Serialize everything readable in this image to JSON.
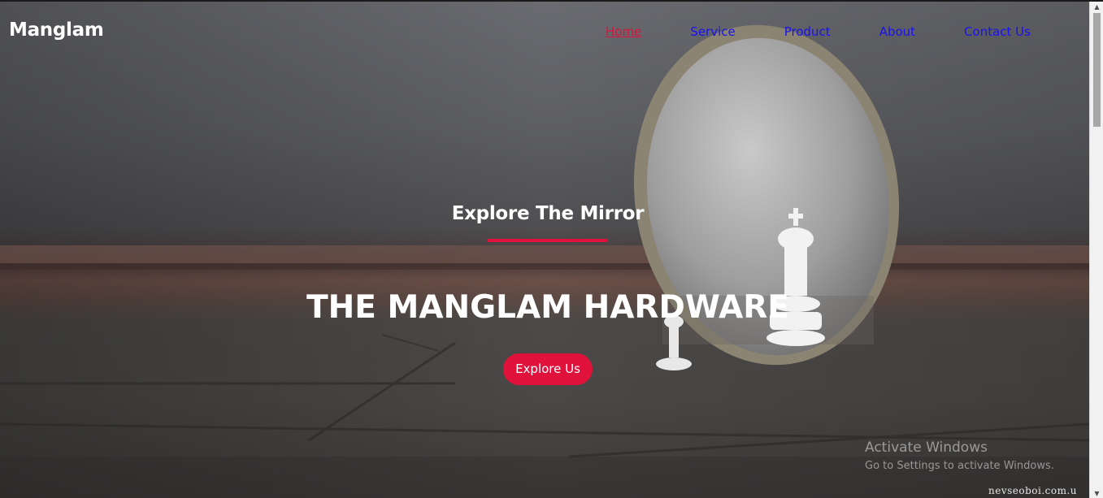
{
  "navbar": {
    "brand": "Manglam",
    "links": [
      {
        "label": "Home",
        "active": true
      },
      {
        "label": "Service",
        "active": false
      },
      {
        "label": "Product",
        "active": false
      },
      {
        "label": "About",
        "active": false
      },
      {
        "label": "Contact Us",
        "active": false
      }
    ]
  },
  "hero": {
    "subtitle": "Explore The Mirror",
    "title": "THE MANGLAM HARDWARE",
    "cta_label": "Explore Us",
    "background_image": "mirror-chess-king-photo"
  },
  "watermark": {
    "title": "Activate Windows",
    "subtitle": "Go to Settings to activate Windows."
  },
  "image_credit": "nevseoboi.com.u",
  "colors": {
    "accent": "#e0113a",
    "nav_link": "#1a10f0",
    "text_light": "#ffffff"
  }
}
